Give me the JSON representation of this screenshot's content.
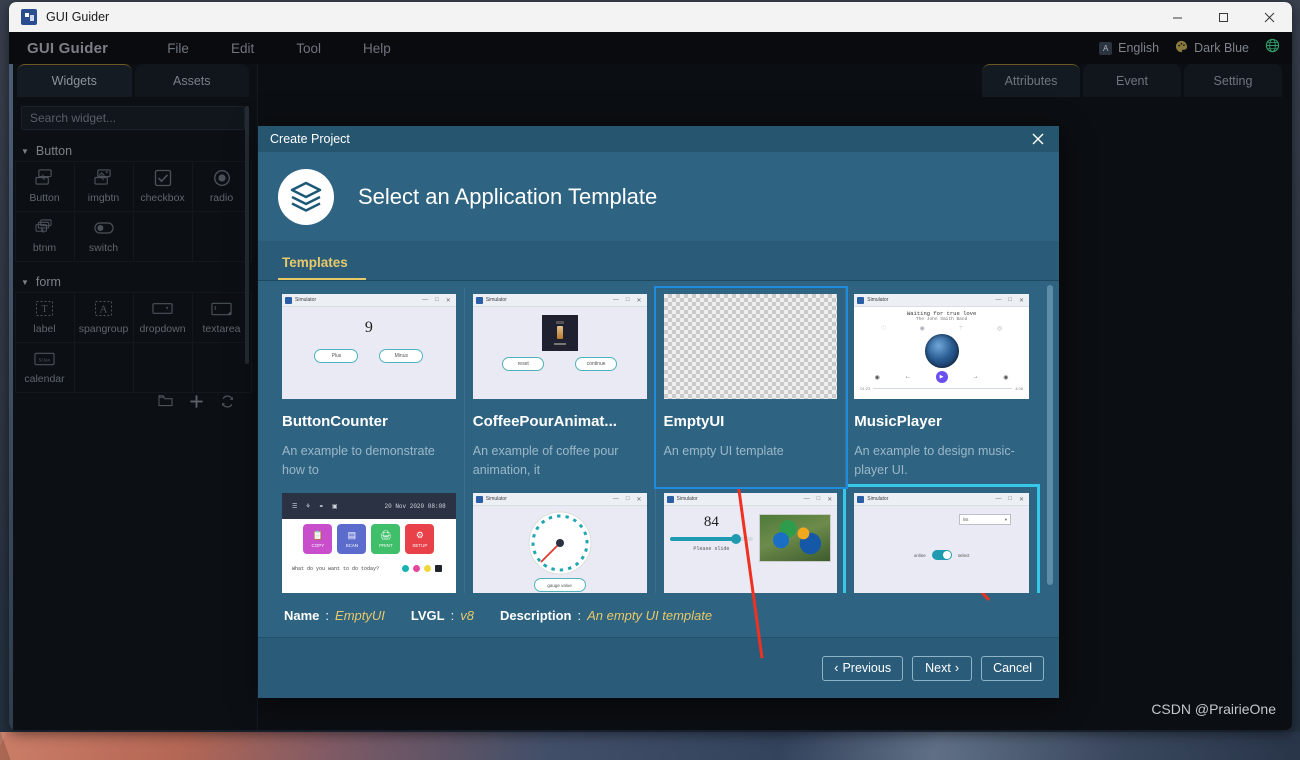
{
  "window": {
    "title": "GUI Guider",
    "icon": "app-icon",
    "controls": {
      "minimize": "—",
      "maximize": "☐",
      "close": "✕"
    }
  },
  "menubar": {
    "brand": "GUI Guider",
    "items": [
      "File",
      "Edit",
      "Tool",
      "Help"
    ],
    "language": "English",
    "theme": "Dark Blue",
    "globe_icon": "globe-icon",
    "palette_icon": "palette-icon",
    "lang_icon": "language-icon"
  },
  "left_panel": {
    "tabs": [
      "Widgets",
      "Assets"
    ],
    "active_tab": "Widgets",
    "search_placeholder": "Search widget...",
    "groups": [
      {
        "name": "Button",
        "widgets": [
          {
            "label": "Button",
            "icon": "button-icon"
          },
          {
            "label": "imgbtn",
            "icon": "image-button-icon"
          },
          {
            "label": "checkbox",
            "icon": "checkbox-icon"
          },
          {
            "label": "radio",
            "icon": "radio-icon"
          },
          {
            "label": "btnm",
            "icon": "button-matrix-icon"
          },
          {
            "label": "switch",
            "icon": "switch-icon"
          }
        ]
      },
      {
        "name": "form",
        "widgets": [
          {
            "label": "label",
            "icon": "label-icon"
          },
          {
            "label": "spangroup",
            "icon": "spangroup-icon"
          },
          {
            "label": "dropdown",
            "icon": "dropdown-icon"
          },
          {
            "label": "textarea",
            "icon": "textarea-icon"
          },
          {
            "label": "calendar",
            "icon": "calendar-icon"
          }
        ]
      }
    ],
    "tools": [
      "folder-icon",
      "plus-icon",
      "refresh-icon"
    ]
  },
  "right_panel": {
    "tabs": [
      "Attributes",
      "Event",
      "Setting"
    ],
    "active_tab": "Attributes"
  },
  "dialog": {
    "title": "Create Project",
    "close_icon": "close-icon",
    "heading": "Select an Application Template",
    "logo_icon": "layers-icon",
    "tab": "Templates",
    "templates": [
      {
        "name": "ButtonCounter",
        "description": "An example to demonstrate how to",
        "state": "normal",
        "sim_title": "Simulator",
        "preview": {
          "kind": "counter",
          "value": "9",
          "buttons": [
            "Plus",
            "Minus"
          ]
        }
      },
      {
        "name": "CoffeePourAnimat...",
        "description": "An example of coffee pour animation, it",
        "state": "normal",
        "sim_title": "Simulator",
        "preview": {
          "kind": "coffee",
          "buttons": [
            "reset",
            "continue"
          ]
        }
      },
      {
        "name": "EmptyUI",
        "description": "An empty UI template",
        "state": "selected",
        "sim_title": "",
        "preview": {
          "kind": "checker"
        }
      },
      {
        "name": "MusicPlayer",
        "description": "An example to design music-player UI.",
        "state": "normal",
        "sim_title": "Simulator",
        "preview": {
          "kind": "music",
          "song": "Waiting for true love",
          "artist": "The John Smith Band",
          "time_left": "01:23",
          "time_right": "4:08"
        }
      },
      {
        "name": "",
        "description": "",
        "state": "normal",
        "sim_title": "",
        "preview": {
          "kind": "printer",
          "datetime": "20 Nov 2020 08:08",
          "prompt": "What do you want to do today?",
          "tiles": [
            {
              "label": "COPY",
              "color": "#c council"
            },
            {
              "label": "SCAN",
              "color": "#5b6ccd"
            },
            {
              "label": "PRINT",
              "color": "#3fbf6a"
            },
            {
              "label": "SETUP",
              "color": "#e8414a"
            }
          ],
          "ink": [
            "#16b3b3",
            "#e8459c",
            "#f0d73c",
            "#20242b"
          ]
        }
      },
      {
        "name": "",
        "description": "",
        "state": "normal",
        "sim_title": "Simulator",
        "preview": {
          "kind": "gauge",
          "caption": "gauge value"
        }
      },
      {
        "name": "",
        "description": "",
        "state": "normal",
        "sim_title": "Simulator",
        "preview": {
          "kind": "slider",
          "value": "84",
          "caption": "Please slide"
        }
      },
      {
        "name": "",
        "description": "",
        "state": "hover",
        "sim_title": "Simulator",
        "preview": {
          "kind": "switch",
          "dropdown": "list",
          "left_label": "online",
          "right_label": "select"
        }
      }
    ],
    "info": {
      "name_key": "Name",
      "name_value": "EmptyUI",
      "lvgl_key": "LVGL",
      "lvgl_value": "v8",
      "desc_key": "Description",
      "desc_value": "An empty UI template"
    },
    "buttons": {
      "previous": "Previous",
      "previous_icon": "chevron-left-icon",
      "next": "Next",
      "next_icon": "chevron-right-icon",
      "cancel": "Cancel"
    }
  },
  "watermark": "CSDN @PrairieOne",
  "colors": {
    "dialog_bg": "#2e6382",
    "dialog_header": "#26566f",
    "accent_gold": "#e8c96a",
    "selected_border": "#1f8ce0",
    "hover_border": "#35c8e8",
    "arrow_red": "#f03020"
  }
}
